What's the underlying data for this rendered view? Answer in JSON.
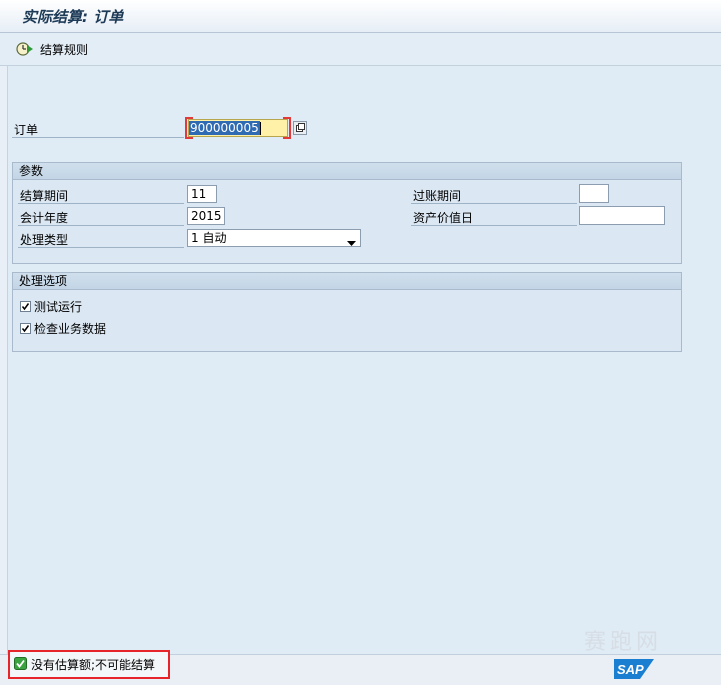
{
  "window": {
    "title": "实际结算: 订单"
  },
  "toolbar": {
    "settle_rules_label": "结算规则"
  },
  "order": {
    "label": "订单",
    "value": "900000005"
  },
  "params": {
    "title": "参数",
    "settlement_period_label": "结算期间",
    "settlement_period_value": "11",
    "fiscal_year_label": "会计年度",
    "fiscal_year_value": "2015",
    "processing_type_label": "处理类型",
    "processing_type_value": "1 自动",
    "posting_period_label": "过账期间",
    "posting_period_value": "",
    "asset_value_date_label": "资产价值日",
    "asset_value_date_value": ""
  },
  "options": {
    "title": "处理选项",
    "test_run_label": "测试运行",
    "test_run_checked": true,
    "check_trans_label": "检查业务数据",
    "check_trans_checked": true
  },
  "status": {
    "message": "没有估算额;不可能结算",
    "type": "success"
  },
  "branding": {
    "logo_text": "SAP",
    "watermark_text": "赛跑网"
  },
  "colors": {
    "status_border": "#e8242b",
    "focus_field": "#fff1a8",
    "sap_blue": "#1b7fd1"
  }
}
